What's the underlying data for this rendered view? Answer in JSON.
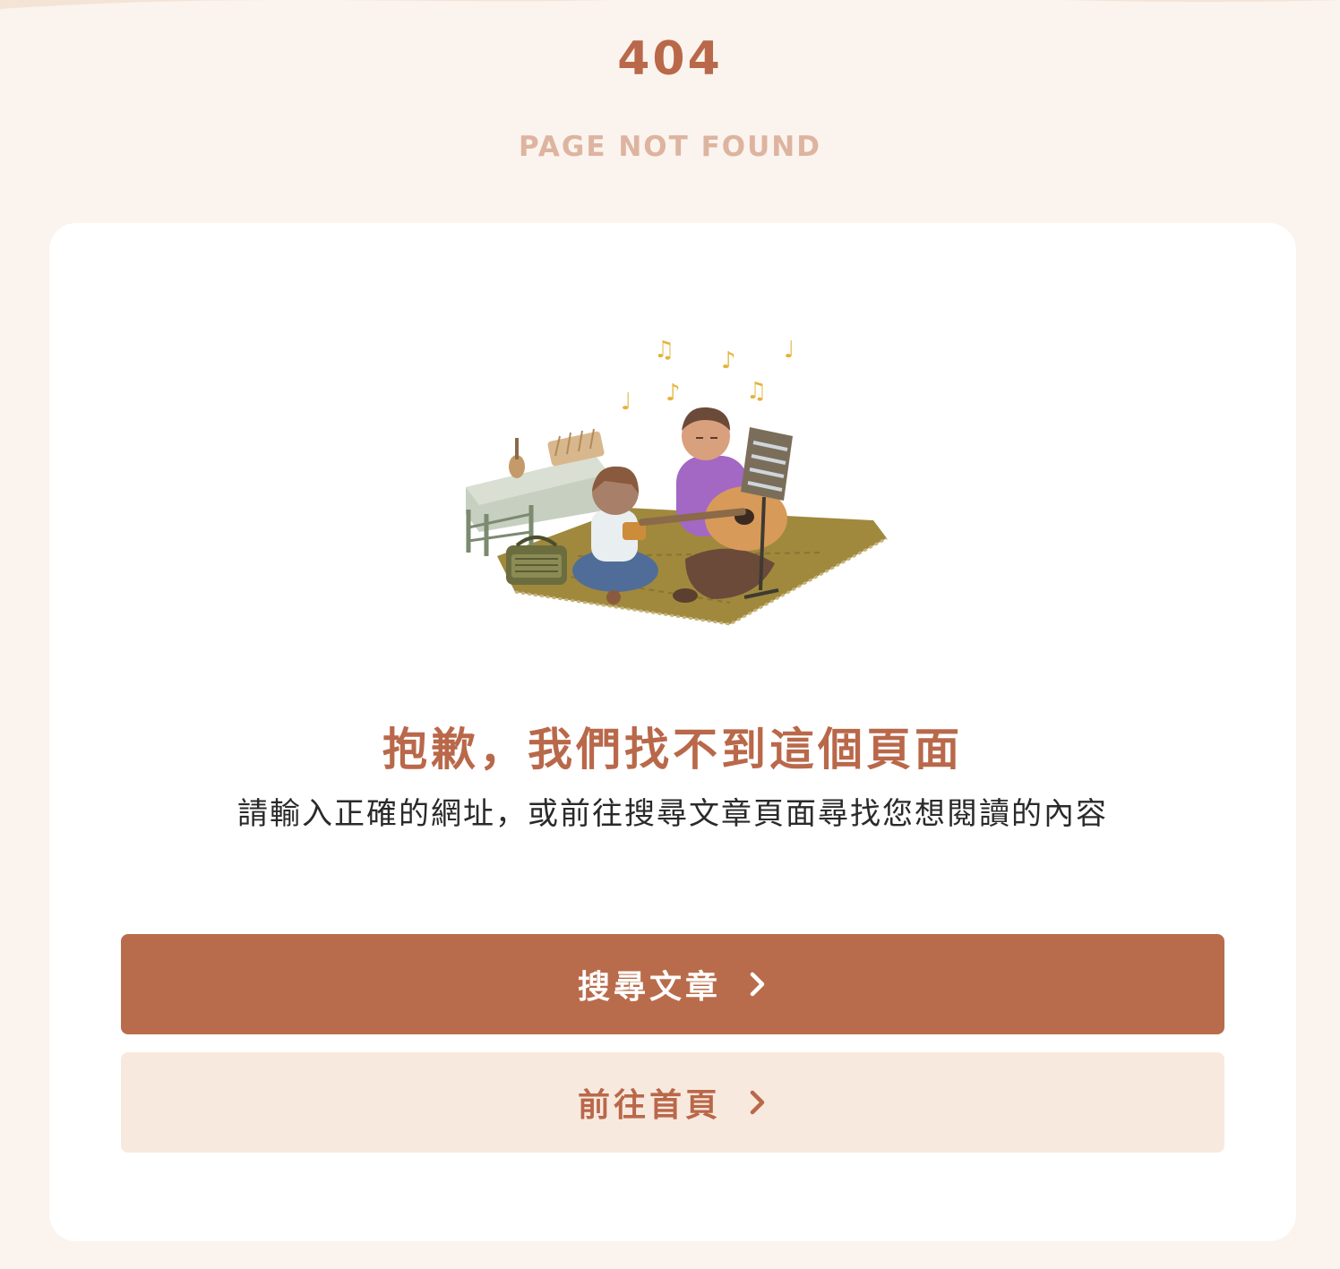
{
  "header": {
    "code": "404",
    "subtitle": "PAGE NOT FOUND"
  },
  "card": {
    "headline": "抱歉，我們找不到這個頁面",
    "description": "請輸入正確的網址，或前往搜尋文章頁面尋找您想閱讀的內容",
    "illustration_icon": "music-picnic-illustration"
  },
  "actions": {
    "search_label": "搜尋文章",
    "home_label": "前往首頁",
    "arrow_icon": "chevron-right-icon"
  },
  "colors": {
    "background": "#fbf3ee",
    "accent": "#b9684a",
    "primary_button": "#b96c4b",
    "secondary_button": "#f8e9df",
    "subtitle": "#ddb49f"
  }
}
